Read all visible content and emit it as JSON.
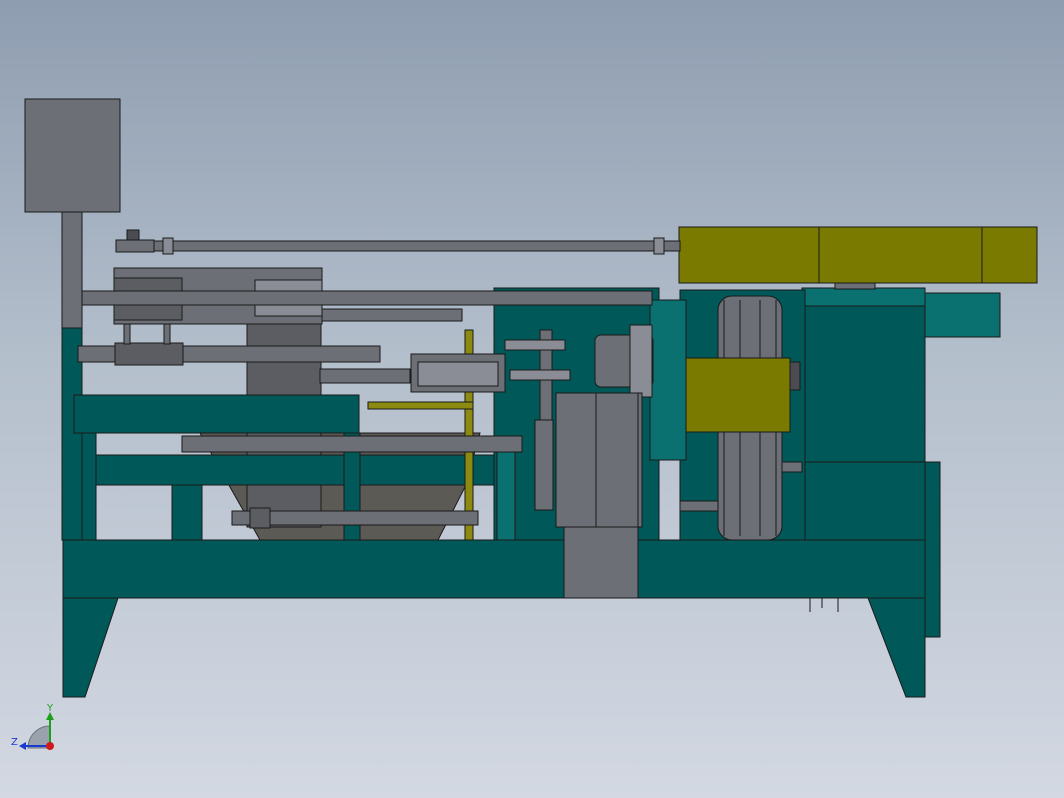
{
  "viewport": {
    "background_top": "#8e9db0",
    "background_bottom": "#d3d8e2"
  },
  "colors": {
    "frame_teal": "#005858",
    "teal_light": "#0a7070",
    "steel_gray": "#6c6f76",
    "steel_dark": "#4a4c52",
    "steel_light": "#8a8d95",
    "olive": "#7a7a00",
    "olive_light": "#8c8a10",
    "hopper_gray": "#5c5a55",
    "outline": "#1a1a1a"
  },
  "model": {
    "description_icon": "cad-machine-side-view-icon"
  },
  "triad": {
    "icon": "axis-triad-icon",
    "y_label": "Y",
    "z_label": "Z",
    "y_color": "#1aa01a",
    "z_color": "#1a3ad0",
    "x_color": "#d01a1a"
  }
}
